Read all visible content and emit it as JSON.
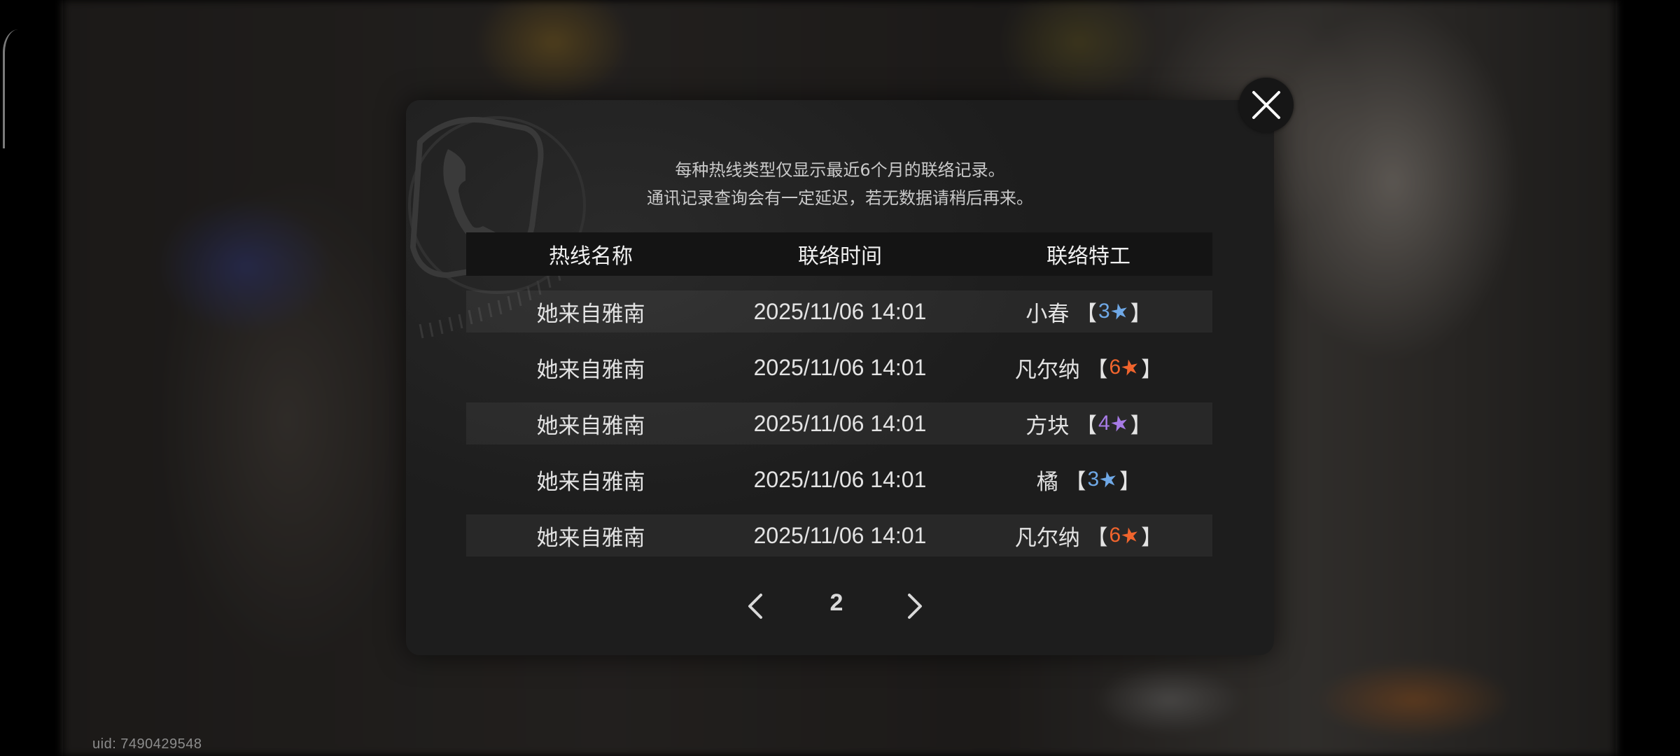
{
  "uid_text": "uid: 7490429548",
  "dialog": {
    "notice_line1": "每种热线类型仅显示最近6个月的联络记录。",
    "notice_line2": "通讯记录查询会有一定延迟，若无数据请稍后再来。",
    "table": {
      "headers": [
        "热线名称",
        "联络时间",
        "联络特工"
      ],
      "rows": [
        {
          "hotline": "她来自雅南",
          "time": "2025/11/06 14:01",
          "agent": "小春",
          "rank": "3",
          "rank_color": "#6fa8e6"
        },
        {
          "hotline": "她来自雅南",
          "time": "2025/11/06 14:01",
          "agent": "凡尔纳",
          "rank": "6",
          "rank_color": "#f0642d"
        },
        {
          "hotline": "她来自雅南",
          "time": "2025/11/06 14:01",
          "agent": "方块",
          "rank": "4",
          "rank_color": "#a77be6"
        },
        {
          "hotline": "她来自雅南",
          "time": "2025/11/06 14:01",
          "agent": "橘",
          "rank": "3",
          "rank_color": "#6fa8e6"
        },
        {
          "hotline": "她来自雅南",
          "time": "2025/11/06 14:01",
          "agent": "凡尔纳",
          "rank": "6",
          "rank_color": "#f0642d"
        }
      ]
    },
    "pagination": {
      "current_page": "2",
      "prev_icon": "chevron-left-icon",
      "next_icon": "chevron-right-icon"
    }
  },
  "close_icon": "close-icon",
  "colors": {
    "rank_3": "#6fa8e6",
    "rank_4": "#a77be6",
    "rank_6": "#f0642d",
    "dialog_bg": "#222222",
    "header_bg": "#141414"
  }
}
